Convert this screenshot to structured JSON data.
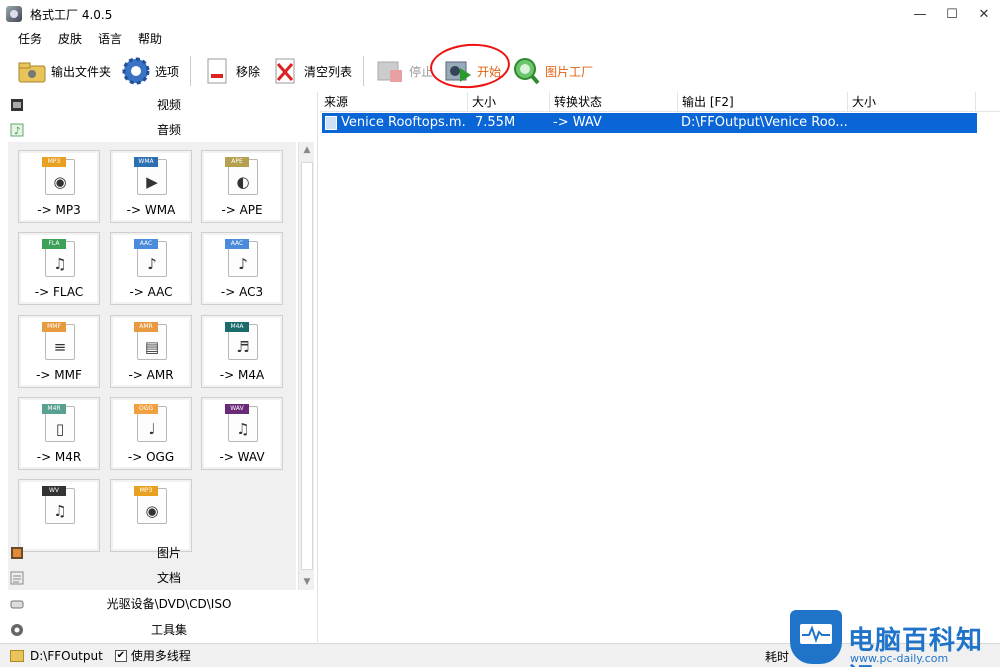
{
  "window": {
    "title": "格式工厂 4.0.5",
    "minimize": "—",
    "maximize": "☐",
    "close": "✕"
  },
  "menu": [
    "任务",
    "皮肤",
    "语言",
    "帮助"
  ],
  "toolbar": {
    "output_folder": "输出文件夹",
    "options": "选项",
    "remove": "移除",
    "clear_list": "清空列表",
    "stop": "停止",
    "start": "开始",
    "picture_factory": "图片工厂"
  },
  "categories": {
    "video": "视频",
    "audio": "音频",
    "picture": "图片",
    "document": "文档",
    "optical": "光驱设备\\DVD\\CD\\ISO",
    "tools": "工具集"
  },
  "tiles": [
    {
      "label": "-> MP3",
      "tag": "MP3",
      "color": "#e8a020",
      "glyph": "◉"
    },
    {
      "label": "-> WMA",
      "tag": "WMA",
      "color": "#2d6fb3",
      "glyph": "▶"
    },
    {
      "label": "-> APE",
      "tag": "APE",
      "color": "#b5a050",
      "glyph": "◐"
    },
    {
      "label": "-> FLAC",
      "tag": "FLA",
      "color": "#3fa05a",
      "glyph": "♫"
    },
    {
      "label": "-> AAC",
      "tag": "AAC",
      "color": "#4a8bdb",
      "glyph": "♪"
    },
    {
      "label": "-> AC3",
      "tag": "AAC",
      "color": "#4a8bdb",
      "glyph": "♪"
    },
    {
      "label": "-> MMF",
      "tag": "MMF",
      "color": "#e89a40",
      "glyph": "≡"
    },
    {
      "label": "-> AMR",
      "tag": "AMR",
      "color": "#e89a40",
      "glyph": "▤"
    },
    {
      "label": "-> M4A",
      "tag": "M4A",
      "color": "#1c6b6b",
      "glyph": "♬"
    },
    {
      "label": "-> M4R",
      "tag": "M4R",
      "color": "#5aa090",
      "glyph": "▯"
    },
    {
      "label": "-> OGG",
      "tag": "OGG",
      "color": "#f0a040",
      "glyph": "♩"
    },
    {
      "label": "-> WAV",
      "tag": "WAV",
      "color": "#6a2a7a",
      "glyph": "♫"
    },
    {
      "label": "",
      "tag": "WV",
      "color": "#333333",
      "glyph": "♫"
    },
    {
      "label": "",
      "tag": "MP3",
      "color": "#e8a020",
      "glyph": "◉"
    }
  ],
  "table": {
    "headers": [
      "来源",
      "大小",
      "转换状态",
      "输出 [F2]",
      "大小"
    ],
    "rows": [
      {
        "source": "Venice Rooftops.m...",
        "size": "7.55M",
        "status": "-> WAV",
        "output": "D:\\FFOutput\\Venice Roo...",
        "out_size": ""
      }
    ]
  },
  "status": {
    "output_path": "D:\\FFOutput",
    "multithread": "使用多线程",
    "elapsed": "耗时",
    "checked": "✔"
  },
  "watermark": {
    "title": "电脑百科知识",
    "url": "www.pc-daily.com"
  }
}
